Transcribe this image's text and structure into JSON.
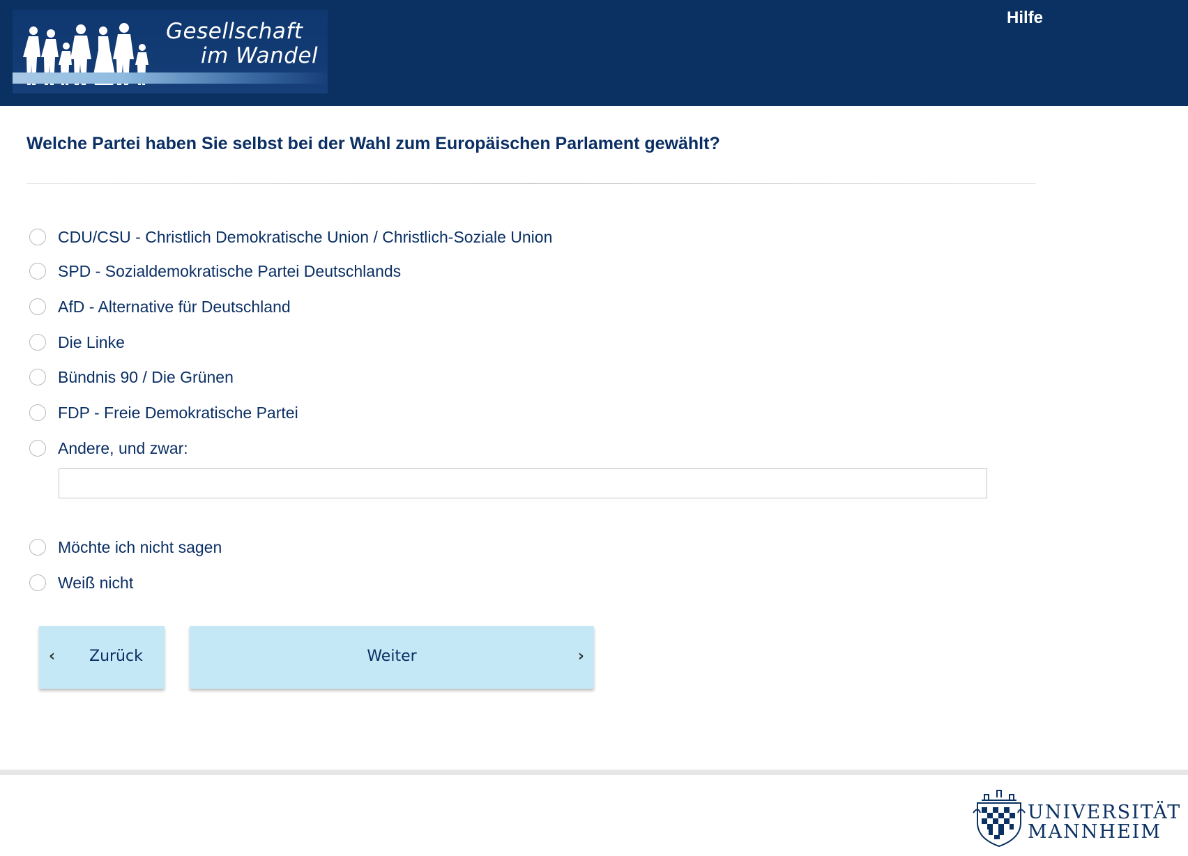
{
  "header": {
    "logo": {
      "line1": "Gesellschaft",
      "line2": "im Wandel"
    },
    "help_label": "Hilfe"
  },
  "question": {
    "text": "Welche Partei haben Sie selbst bei der Wahl zum Europäischen Parlament gewählt?"
  },
  "options": [
    {
      "label": "CDU/CSU - Christlich Demokratische Union / Christlich-Soziale Union",
      "selected": false
    },
    {
      "label": "SPD - Sozialdemokratische Partei Deutschlands",
      "selected": false
    },
    {
      "label": "AfD - Alternative für Deutschland",
      "selected": false
    },
    {
      "label": "Die Linke",
      "selected": false
    },
    {
      "label": "Bündnis 90 / Die Grünen",
      "selected": false
    },
    {
      "label": "FDP - Freie Demokratische Partei",
      "selected": false
    },
    {
      "label": "Andere, und zwar:",
      "selected": false
    },
    {
      "label": "Möchte ich nicht sagen",
      "selected": false
    },
    {
      "label": "Weiß nicht",
      "selected": false
    }
  ],
  "other_input": {
    "value": "",
    "placeholder": ""
  },
  "nav": {
    "back_label": "Zurück",
    "next_label": "Weiter"
  },
  "footer": {
    "university_line1": "UNIVERSITÄT",
    "university_line2": "MANNHEIM"
  },
  "colors": {
    "header_bg": "#0b3163",
    "text_primary": "#0a2f64",
    "button_bg": "#c5e8f6"
  }
}
